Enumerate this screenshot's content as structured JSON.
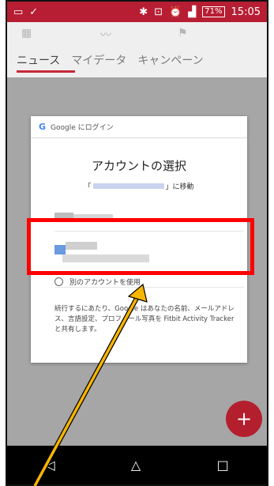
{
  "status_bar": {
    "left_icons": [
      "screen-icon",
      "check-icon"
    ],
    "right_icons": [
      "bluetooth-icon",
      "vibrate-icon",
      "alarm-icon",
      "signal-icon"
    ],
    "battery": "71%",
    "time": "15:05"
  },
  "app": {
    "tabs": [
      {
        "label": "ニュース",
        "active": true
      },
      {
        "label": "マイデータ",
        "active": false
      },
      {
        "label": "キャンペーン",
        "active": false
      }
    ],
    "accent_color": "#c62a3a"
  },
  "dialog": {
    "header": "Google にログイン",
    "title": "アカウントの選択",
    "sub_prefix": "「",
    "sub_suffix": "」に移動",
    "use_other_account": "別のアカウントを使用",
    "consent": "続行するにあたり、Google はあなたの名前、メールアドレス、言語設定、プロフィール写真を Fitbit Activity Tracker と共有します。"
  },
  "fab": {
    "label": "+"
  },
  "nav": {
    "back": "◁",
    "home": "△",
    "recents": "□"
  },
  "annotation": {
    "highlight_color": "#ff0000",
    "arrow_color": "#f7b500"
  }
}
